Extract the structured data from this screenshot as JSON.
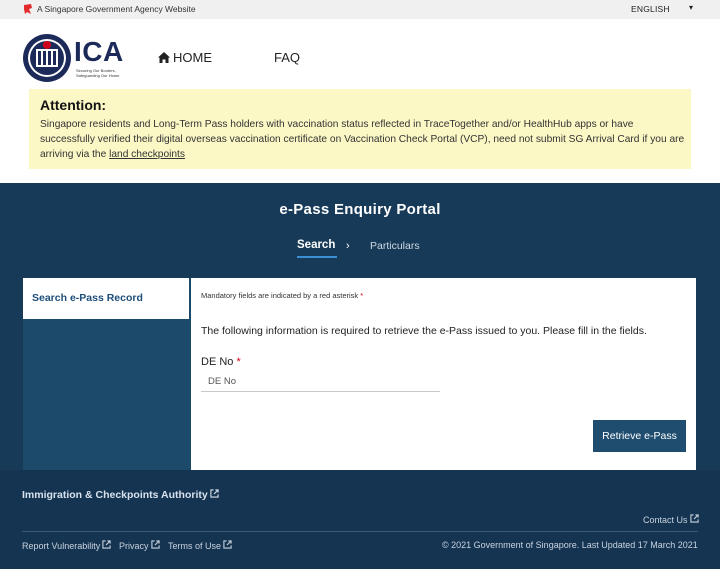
{
  "gov_bar": {
    "text": "A Singapore Government Agency Website",
    "language": "ENGLISH",
    "icons": {
      "lion": "singapore-lion-icon",
      "chevron": "chevron-down-icon"
    }
  },
  "header": {
    "logo_text": "ICA",
    "logo_tagline": "Securing Our Borders, Safeguarding Our Home",
    "nav": {
      "home": "HOME",
      "faq": "FAQ"
    },
    "icons": {
      "home": "home-icon"
    }
  },
  "attention": {
    "title": "Attention:",
    "body": "Singapore residents and Long-Term Pass holders with vaccination status reflected in TraceTogether and/or HealthHub apps or have successfully verified their digital overseas vaccination certificate on Vaccination Check Portal (VCP), need not submit SG Arrival Card if you are arriving via the",
    "link": "land checkpoints"
  },
  "portal": {
    "title": "e-Pass Enquiry Portal",
    "steps": [
      "Search",
      "Particulars"
    ],
    "active_step": "Search"
  },
  "sidebar": {
    "item": "Search e-Pass Record"
  },
  "form": {
    "mandatory_note": "Mandatory fields are indicated by a red asterisk",
    "asterisk": "*",
    "info": "The following information is required to retrieve the e-Pass issued to you. Please fill in the fields.",
    "de_label": "DE No",
    "de_placeholder": "DE No",
    "submit": "Retrieve e-Pass"
  },
  "footer": {
    "authority": "Immigration & Checkpoints Authority",
    "contact": "Contact Us",
    "links": [
      "Report Vulnerability",
      "Privacy",
      "Terms of Use"
    ],
    "copyright": "© 2021 Government of Singapore. Last Updated 17 March 2021"
  },
  "colors": {
    "navy_band": "#173a58",
    "footer": "#143452",
    "attention_bg": "#fbf8c6",
    "button": "#1e4d70",
    "asterisk": "#d0021b"
  }
}
